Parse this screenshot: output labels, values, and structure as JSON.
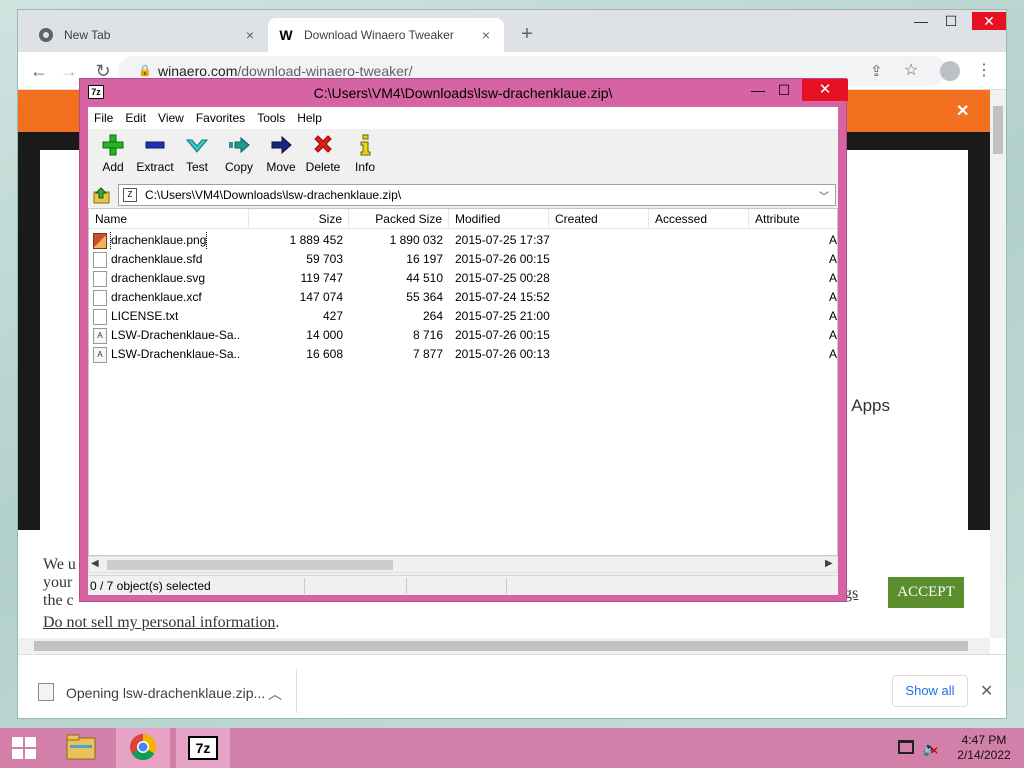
{
  "browser": {
    "tabs": [
      {
        "title": "New Tab",
        "close": "×"
      },
      {
        "title": "Download Winaero Tweaker",
        "close": "×"
      }
    ],
    "new_tab": "+",
    "url_host": "winaero.com",
    "url_path": "/download-winaero-tweaker/",
    "window_controls": {
      "min": "—",
      "max": "☐",
      "close": "✕"
    }
  },
  "page": {
    "apps_text": "o Apps",
    "cookie_lines": [
      "We u",
      "your",
      "the c"
    ],
    "settings_link": "ngs",
    "accept_label": "ACCEPT",
    "do_not_sell": "Do not sell my personal information",
    "do_not_sell_period": "."
  },
  "download_bar": {
    "text": "Opening lsw-drachenklaue.zip...",
    "show_all": "Show all"
  },
  "zip": {
    "title": "C:\\Users\\VM4\\Downloads\\lsw-drachenklaue.zip\\",
    "app_icon_text": "7z",
    "controls": {
      "min": "—",
      "max": "☐",
      "close": "✕"
    },
    "menu": [
      "File",
      "Edit",
      "View",
      "Favorites",
      "Tools",
      "Help"
    ],
    "toolbar": [
      {
        "label": "Add",
        "icon": "add-icon"
      },
      {
        "label": "Extract",
        "icon": "extract-icon"
      },
      {
        "label": "Test",
        "icon": "test-icon"
      },
      {
        "label": "Copy",
        "icon": "copy-icon"
      },
      {
        "label": "Move",
        "icon": "move-icon"
      },
      {
        "label": "Delete",
        "icon": "delete-icon"
      },
      {
        "label": "Info",
        "icon": "info-icon"
      }
    ],
    "address": "C:\\Users\\VM4\\Downloads\\lsw-drachenklaue.zip\\",
    "columns": [
      "Name",
      "Size",
      "Packed Size",
      "Modified",
      "Created",
      "Accessed",
      "Attribute"
    ],
    "files": [
      {
        "name": "drachenklaue.png",
        "size": "1 889 452",
        "packed": "1 890 032",
        "modified": "2015-07-25 17:37",
        "attr": "A",
        "type": "png"
      },
      {
        "name": "drachenklaue.sfd",
        "size": "59 703",
        "packed": "16 197",
        "modified": "2015-07-26 00:15",
        "attr": "A",
        "type": "doc"
      },
      {
        "name": "drachenklaue.svg",
        "size": "119 747",
        "packed": "44 510",
        "modified": "2015-07-25 00:28",
        "attr": "A",
        "type": "doc"
      },
      {
        "name": "drachenklaue.xcf",
        "size": "147 074",
        "packed": "55 364",
        "modified": "2015-07-24 15:52",
        "attr": "A",
        "type": "doc"
      },
      {
        "name": "LICENSE.txt",
        "size": "427",
        "packed": "264",
        "modified": "2015-07-25 21:00",
        "attr": "A",
        "type": "doc"
      },
      {
        "name": "LSW-Drachenklaue-Sa...",
        "size": "14 000",
        "packed": "8 716",
        "modified": "2015-07-26 00:15",
        "attr": "A",
        "type": "font"
      },
      {
        "name": "LSW-Drachenklaue-Sa...",
        "size": "16 608",
        "packed": "7 877",
        "modified": "2015-07-26 00:13",
        "attr": "A",
        "type": "font"
      }
    ],
    "status": "0 / 7 object(s) selected"
  },
  "taskbar": {
    "seven_zip_label": "7z",
    "time": "4:47 PM",
    "date": "2/14/2022"
  },
  "colors": {
    "zip_frame": "#d664a5",
    "taskbar": "#d27fa9",
    "orange_bar": "#f37021",
    "accept": "#5b8e2d"
  }
}
